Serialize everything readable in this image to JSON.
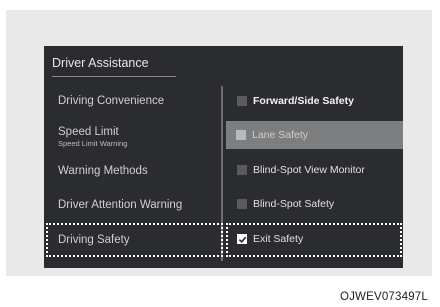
{
  "screen": {
    "title": "Driver Assistance"
  },
  "left_menu": {
    "items": [
      {
        "label": "Driving Convenience"
      },
      {
        "label": "Speed Limit",
        "sublabel": "Speed Limit Warning"
      },
      {
        "label": "Warning Methods"
      },
      {
        "label": "Driver Attention Warning"
      },
      {
        "label": "Driving Safety",
        "highlighted": true
      }
    ]
  },
  "right_options": {
    "items": [
      {
        "label": "Forward/Side Safety",
        "checked": false
      },
      {
        "label": "Lane Safety",
        "checked": false,
        "selected": true
      },
      {
        "label": "Blind-Spot View Monitor",
        "checked": false
      },
      {
        "label": "Blind-Spot Safety",
        "checked": false
      },
      {
        "label": "Exit Safety",
        "checked": true,
        "highlighted": true
      }
    ]
  },
  "caption": "OJWEV073497L",
  "colors": {
    "screen_bg": "#2b2c30",
    "selected_row": "#7d7e80",
    "highlight_border": "#ffffff"
  }
}
